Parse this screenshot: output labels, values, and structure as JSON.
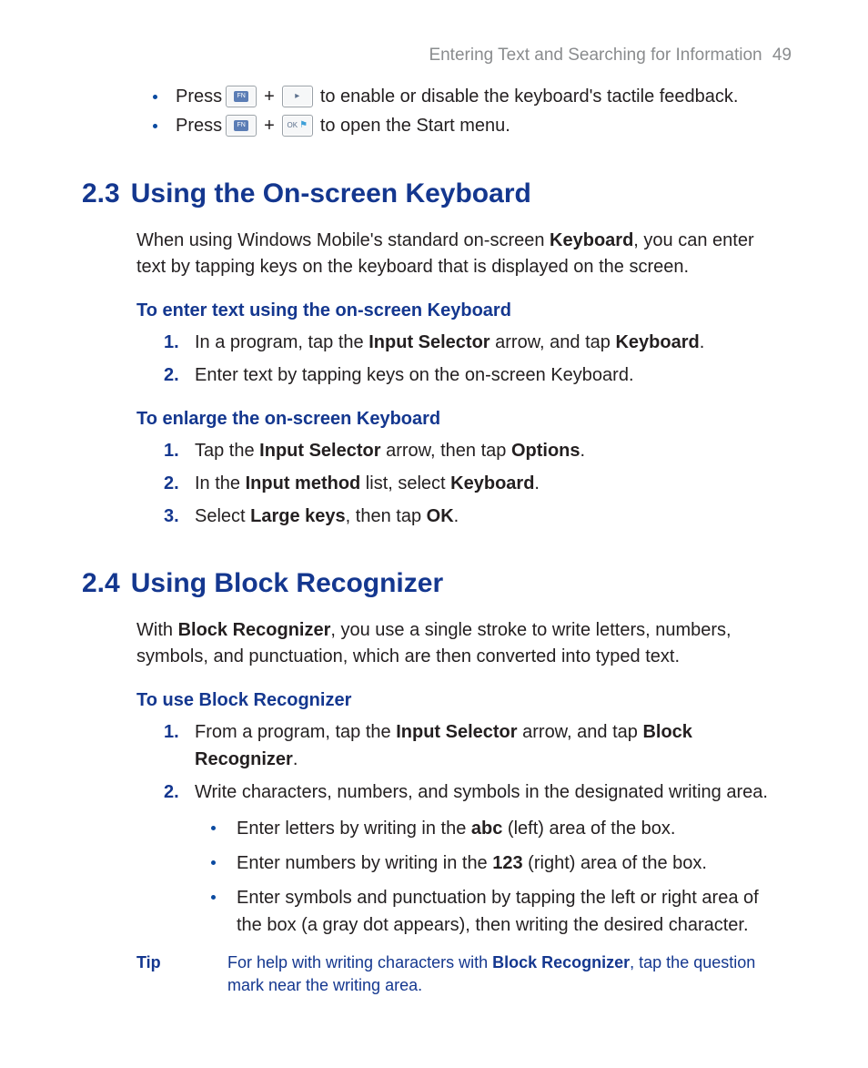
{
  "header": {
    "title": "Entering Text and Searching for Information",
    "page": "49"
  },
  "top_bullets": {
    "item1": {
      "pre": "Press",
      "mid": " + ",
      "post": "to enable or disable the keyboard's tactile feedback."
    },
    "item2": {
      "pre": "Press",
      "mid": " + ",
      "post": "to open the Start menu."
    }
  },
  "keys": {
    "fn": "FN",
    "ok": "OK"
  },
  "s23": {
    "num": "2.3",
    "title": "Using the On-screen Keyboard",
    "intro_a": "When using Windows Mobile's standard on-screen ",
    "intro_b": "Keyboard",
    "intro_c": ", you can enter text by tapping keys on the keyboard that is displayed on the screen.",
    "sub1": "To enter text using the on-screen Keyboard",
    "sub1_steps": {
      "s1a": "In a program, tap the ",
      "s1b": "Input Selector",
      "s1c": " arrow, and tap ",
      "s1d": "Keyboard",
      "s1e": ".",
      "s2": "Enter text by tapping keys on the on-screen Keyboard."
    },
    "sub2": "To enlarge the on-screen Keyboard",
    "sub2_steps": {
      "s1a": "Tap the ",
      "s1b": "Input Selector",
      "s1c": " arrow, then tap ",
      "s1d": "Options",
      "s1e": ".",
      "s2a": "In the ",
      "s2b": "Input method",
      "s2c": " list, select ",
      "s2d": "Keyboard",
      "s2e": ".",
      "s3a": "Select ",
      "s3b": "Large keys",
      "s3c": ", then tap ",
      "s3d": "OK",
      "s3e": "."
    }
  },
  "s24": {
    "num": "2.4",
    "title": "Using Block Recognizer",
    "intro_a": "With ",
    "intro_b": "Block Recognizer",
    "intro_c": ", you use a single stroke to write letters, numbers, symbols, and punctuation, which are then converted into typed text.",
    "sub1": "To use Block Recognizer",
    "steps": {
      "s1a": "From a program, tap the ",
      "s1b": "Input Selector",
      "s1c": " arrow, and tap ",
      "s1d": "Block Recognizer",
      "s1e": ".",
      "s2": "Write characters, numbers, and symbols in the designated writing area.",
      "sub": {
        "b1a": "Enter letters by writing in the ",
        "b1b": "abc",
        "b1c": " (left) area of the box.",
        "b2a": "Enter numbers by writing in the ",
        "b2b": "123",
        "b2c": " (right) area of the box.",
        "b3": "Enter symbols and punctuation by tapping the left or right area of the box (a gray dot appears), then writing the desired character."
      }
    },
    "tip": {
      "label": "Tip",
      "a": "For help with writing characters with ",
      "b": "Block Recognizer",
      "c": ", tap the question mark near the writing area."
    }
  }
}
